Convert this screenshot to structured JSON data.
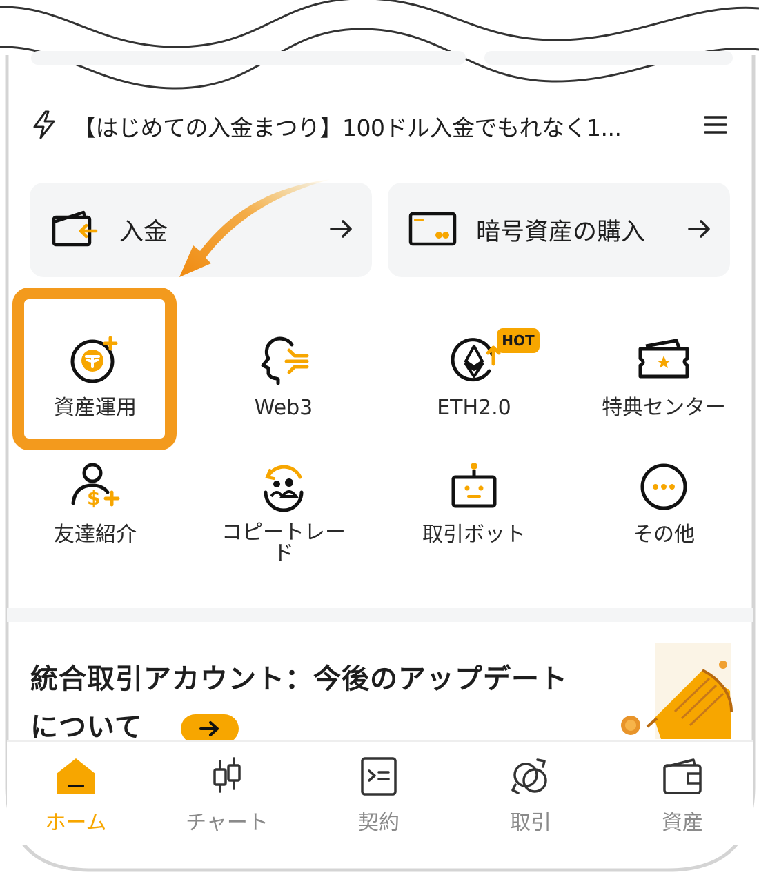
{
  "announcement": {
    "text": "【はじめての入金まつり】100ドル入金でもれなく1..."
  },
  "quick_actions": [
    {
      "label": "入金"
    },
    {
      "label": "暗号資産の購入"
    }
  ],
  "grid": [
    {
      "label": "資産運用",
      "icon": "tether-plus-icon"
    },
    {
      "label": "Web3",
      "icon": "web3-head-icon"
    },
    {
      "label": "ETH2.0",
      "icon": "ethereum-icon",
      "badge": "HOT"
    },
    {
      "label": "特典センター",
      "icon": "ticket-star-icon"
    },
    {
      "label": "友達紹介",
      "icon": "referral-person-icon"
    },
    {
      "label": "コピートレード",
      "icon": "copy-trade-icon"
    },
    {
      "label": "取引ボット",
      "icon": "robot-icon"
    },
    {
      "label": "その他",
      "icon": "more-dots-icon"
    }
  ],
  "news": {
    "title_line1": "統合取引アカウント：今後のアップデート",
    "title_line2": "について"
  },
  "tabs": [
    {
      "label": "ホーム",
      "active": true,
      "icon": "home-icon"
    },
    {
      "label": "チャート",
      "active": false,
      "icon": "candlestick-icon"
    },
    {
      "label": "契約",
      "active": false,
      "icon": "contract-icon"
    },
    {
      "label": "取引",
      "active": false,
      "icon": "trade-icon"
    },
    {
      "label": "資産",
      "active": false,
      "icon": "wallet-icon"
    }
  ],
  "colors": {
    "accent": "#f7a600",
    "highlight": "#f39a1d",
    "card_bg": "#f4f5f6"
  }
}
